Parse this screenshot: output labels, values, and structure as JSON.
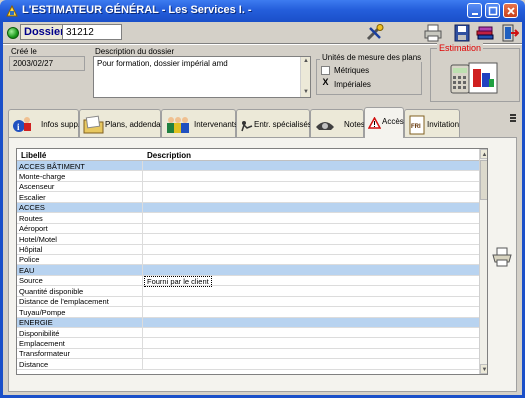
{
  "window": {
    "title": "L'ESTIMATEUR GÉNÉRAL - Les Services I. -"
  },
  "header": {
    "dossier_label": "Dossier",
    "dossier_number": "31212"
  },
  "info": {
    "created_label": "Créé le",
    "created_date": "2003/02/27",
    "description_label": "Description du dossier",
    "description_value": "Pour formation, dossier impérial amd",
    "units_title": "Unités de mesure des plans",
    "unit_metric_label": "Métriques",
    "unit_metric_checked": "",
    "unit_imperial_label": "Impériales",
    "unit_imperial_checked": "X",
    "estimation_label": "Estimation"
  },
  "tabs": [
    {
      "label": "Infos supp."
    },
    {
      "label": "Plans, addenda"
    },
    {
      "label": "Intervenants"
    },
    {
      "label": "Entr. spécialisés"
    },
    {
      "label": "Notes"
    },
    {
      "label": "Accès"
    },
    {
      "label": "Invitation"
    }
  ],
  "active_tab": "Accès",
  "grid": {
    "col_libelle": "Libellé",
    "col_description": "Description",
    "rows": [
      {
        "libelle": "ACCES BÂTIMENT",
        "description": ""
      },
      {
        "libelle": "Monte-charge",
        "description": ""
      },
      {
        "libelle": "Ascenseur",
        "description": ""
      },
      {
        "libelle": "Escalier",
        "description": ""
      },
      {
        "libelle": "ACCES",
        "description": ""
      },
      {
        "libelle": "Routes",
        "description": ""
      },
      {
        "libelle": "Aéroport",
        "description": ""
      },
      {
        "libelle": "Hotel/Motel",
        "description": ""
      },
      {
        "libelle": "Hôpital",
        "description": ""
      },
      {
        "libelle": "Police",
        "description": ""
      },
      {
        "libelle": "EAU",
        "description": ""
      },
      {
        "libelle": "Source",
        "description": "Fourni par le client"
      },
      {
        "libelle": "Quantité disponible",
        "description": ""
      },
      {
        "libelle": "Distance de l'emplacement",
        "description": ""
      },
      {
        "libelle": "Tuyau/Pompe",
        "description": ""
      },
      {
        "libelle": "ENERGIE",
        "description": ""
      },
      {
        "libelle": "Disponibilité",
        "description": ""
      },
      {
        "libelle": "Emplacement",
        "description": ""
      },
      {
        "libelle": "Transformateur",
        "description": ""
      },
      {
        "libelle": "Distance",
        "description": ""
      }
    ]
  },
  "colors": {
    "titlebar": "#245edb",
    "category_row": "#b8d3f0",
    "estimation_title": "#e00000"
  }
}
